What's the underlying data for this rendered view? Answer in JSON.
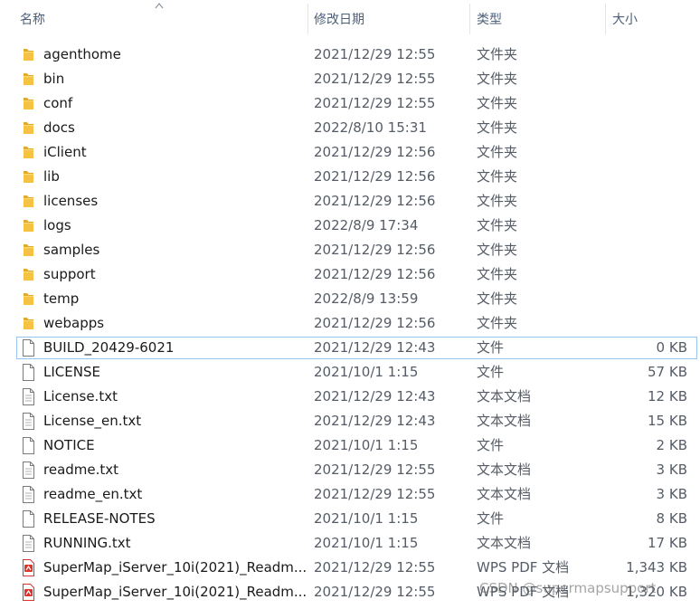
{
  "columns": {
    "name": "名称",
    "date": "修改日期",
    "type": "类型",
    "size": "大小"
  },
  "rows": [
    {
      "name": "agenthome",
      "date": "2021/12/29 12:55",
      "type": "文件夹",
      "size": "",
      "icon": "folder-icon"
    },
    {
      "name": "bin",
      "date": "2021/12/29 12:55",
      "type": "文件夹",
      "size": "",
      "icon": "folder-icon"
    },
    {
      "name": "conf",
      "date": "2021/12/29 12:55",
      "type": "文件夹",
      "size": "",
      "icon": "folder-icon"
    },
    {
      "name": "docs",
      "date": "2022/8/10 15:31",
      "type": "文件夹",
      "size": "",
      "icon": "folder-icon"
    },
    {
      "name": "iClient",
      "date": "2021/12/29 12:56",
      "type": "文件夹",
      "size": "",
      "icon": "folder-icon"
    },
    {
      "name": "lib",
      "date": "2021/12/29 12:56",
      "type": "文件夹",
      "size": "",
      "icon": "folder-icon"
    },
    {
      "name": "licenses",
      "date": "2021/12/29 12:56",
      "type": "文件夹",
      "size": "",
      "icon": "folder-icon"
    },
    {
      "name": "logs",
      "date": "2022/8/9 17:34",
      "type": "文件夹",
      "size": "",
      "icon": "folder-icon"
    },
    {
      "name": "samples",
      "date": "2021/12/29 12:56",
      "type": "文件夹",
      "size": "",
      "icon": "folder-icon"
    },
    {
      "name": "support",
      "date": "2021/12/29 12:56",
      "type": "文件夹",
      "size": "",
      "icon": "folder-icon"
    },
    {
      "name": "temp",
      "date": "2022/8/9 13:59",
      "type": "文件夹",
      "size": "",
      "icon": "folder-icon"
    },
    {
      "name": "webapps",
      "date": "2021/12/29 12:56",
      "type": "文件夹",
      "size": "",
      "icon": "folder-icon"
    },
    {
      "name": "BUILD_20429-6021",
      "date": "2021/12/29 12:43",
      "type": "文件",
      "size": "0 KB",
      "icon": "file-icon",
      "selected": true
    },
    {
      "name": "LICENSE",
      "date": "2021/10/1 1:15",
      "type": "文件",
      "size": "57 KB",
      "icon": "file-icon"
    },
    {
      "name": "License.txt",
      "date": "2021/12/29 12:43",
      "type": "文本文档",
      "size": "12 KB",
      "icon": "text-file-icon"
    },
    {
      "name": "License_en.txt",
      "date": "2021/12/29 12:43",
      "type": "文本文档",
      "size": "15 KB",
      "icon": "text-file-icon"
    },
    {
      "name": "NOTICE",
      "date": "2021/10/1 1:15",
      "type": "文件",
      "size": "2 KB",
      "icon": "file-icon"
    },
    {
      "name": "readme.txt",
      "date": "2021/12/29 12:55",
      "type": "文本文档",
      "size": "3 KB",
      "icon": "text-file-icon"
    },
    {
      "name": "readme_en.txt",
      "date": "2021/12/29 12:55",
      "type": "文本文档",
      "size": "3 KB",
      "icon": "text-file-icon"
    },
    {
      "name": "RELEASE-NOTES",
      "date": "2021/10/1 1:15",
      "type": "文件",
      "size": "8 KB",
      "icon": "file-icon"
    },
    {
      "name": "RUNNING.txt",
      "date": "2021/10/1 1:15",
      "type": "文本文档",
      "size": "17 KB",
      "icon": "text-file-icon"
    },
    {
      "name": "SuperMap_iServer_10i(2021)_Readm...",
      "date": "2021/12/29 12:55",
      "type": "WPS PDF 文档",
      "size": "1,343 KB",
      "icon": "pdf-file-icon"
    },
    {
      "name": "SuperMap_iServer_10i(2021)_Readm...",
      "date": "2021/12/29 12:55",
      "type": "WPS PDF 文档",
      "size": "1,320 KB",
      "icon": "pdf-file-icon"
    }
  ],
  "watermark": "CSDN @supermapsupport",
  "colors": {
    "folder": "#f5c242",
    "header_text": "#4c607a",
    "selection_border": "#99c4f0",
    "pdf_red": "#d9352b"
  }
}
